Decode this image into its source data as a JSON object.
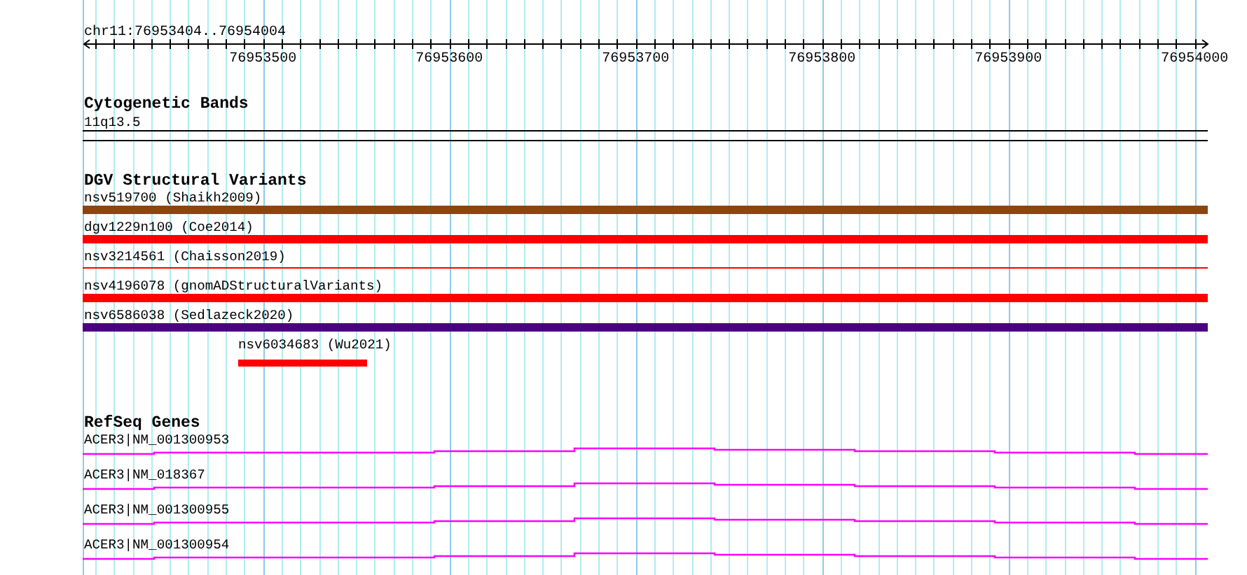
{
  "ruler": {
    "location": "chr11:76953404..76954004",
    "ticks": [
      "76953500",
      "76953600",
      "76953700",
      "76953800",
      "76953900",
      "76954000"
    ]
  },
  "tracks": [
    {
      "kind": "bands",
      "title": "Cytogenetic Bands",
      "items": [
        {
          "label": "11q13.5"
        }
      ]
    },
    {
      "kind": "variants",
      "title": "DGV Structural Variants",
      "items": [
        {
          "label": "nsv519700 (Shaikh2009)",
          "color": "#8b4513",
          "kind": "thick"
        },
        {
          "label": "dgv1229n100 (Coe2014)",
          "color": "#ff0000",
          "kind": "thick"
        },
        {
          "label": "nsv3214561 (Chaisson2019)",
          "color": "#ff0000",
          "kind": "thin"
        },
        {
          "label": "nsv4196078 (gnomADStructuralVariants)",
          "color": "#ff0000",
          "kind": "thick"
        },
        {
          "label": "nsv6586038 (Sedlazeck2020)",
          "color": "#4b0082",
          "kind": "thick"
        },
        {
          "label": "nsv6034683 (Wu2021)",
          "color": "#ff0000",
          "kind": "partial"
        }
      ]
    },
    {
      "kind": "genes",
      "title": "RefSeq Genes",
      "items": [
        {
          "label": "ACER3|NM_001300953"
        },
        {
          "label": "ACER3|NM_018367"
        },
        {
          "label": "ACER3|NM_001300955"
        },
        {
          "label": "ACER3|NM_001300954"
        }
      ]
    }
  ]
}
